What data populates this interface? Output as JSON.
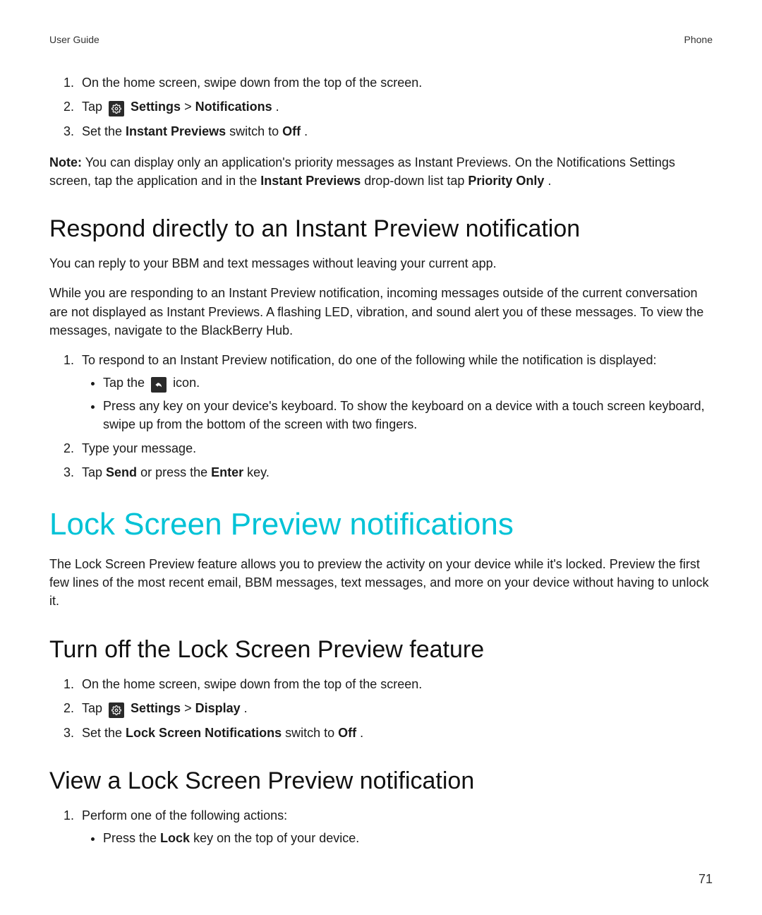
{
  "header": {
    "left": "User Guide",
    "right": "Phone"
  },
  "intro_steps": {
    "s1": "On the home screen, swipe down from the top of the screen.",
    "s2": {
      "tap": "Tap ",
      "settings": "Settings",
      "gt": " > ",
      "target": "Notifications",
      "period": "."
    },
    "s3": {
      "pre": "Set the ",
      "bold": "Instant Previews",
      "mid": " switch to ",
      "bold2": "Off",
      "end": "."
    }
  },
  "note": {
    "label": "Note:",
    "body1": " You can display only an application's priority messages as Instant Previews. On the Notifications Settings screen, tap the application and in the ",
    "bold1": "Instant Previews",
    "body2": " drop-down list tap ",
    "bold2": "Priority Only",
    "end": "."
  },
  "respond": {
    "title": "Respond directly to an Instant Preview notification",
    "p1": "You can reply to your BBM and text messages without leaving your current app.",
    "p2": "While you are responding to an Instant Preview notification, incoming messages outside of the current conversation are not displayed as Instant Previews. A flashing LED, vibration, and sound alert you of these messages. To view the messages, navigate to the BlackBerry Hub.",
    "s1": "To respond to an Instant Preview notification, do one of the following while the notification is displayed:",
    "s1_b1_pre": "Tap the ",
    "s1_b1_post": " icon.",
    "s1_b2": "Press any key on your device's keyboard. To show the keyboard on a device with a touch screen keyboard, swipe up from the bottom of the screen with two fingers.",
    "s2": "Type your message.",
    "s3_pre": "Tap ",
    "s3_b1": "Send",
    "s3_mid": " or press the ",
    "s3_b2": "Enter",
    "s3_end": " key."
  },
  "lock": {
    "chapter": "Lock Screen Preview notifications",
    "intro": "The Lock Screen Preview feature allows you to preview the activity on your device while it's locked. Preview the first few lines of the most recent email, BBM messages, text messages, and more on your device without having to unlock it.",
    "turn_off": {
      "title": "Turn off the Lock Screen Preview feature",
      "s1": "On the home screen, swipe down from the top of the screen.",
      "s2_tap": "Tap ",
      "s2_settings": "Settings",
      "s2_gt": " > ",
      "s2_target": "Display",
      "s2_period": ".",
      "s3_pre": "Set the ",
      "s3_b": "Lock Screen Notifications",
      "s3_mid": " switch to ",
      "s3_b2": "Off",
      "s3_end": "."
    },
    "view": {
      "title": "View a Lock Screen Preview notification",
      "s1": "Perform one of the following actions:",
      "b1_pre": "Press the ",
      "b1_b": "Lock",
      "b1_post": " key on the top of your device."
    }
  },
  "page_number": "71"
}
